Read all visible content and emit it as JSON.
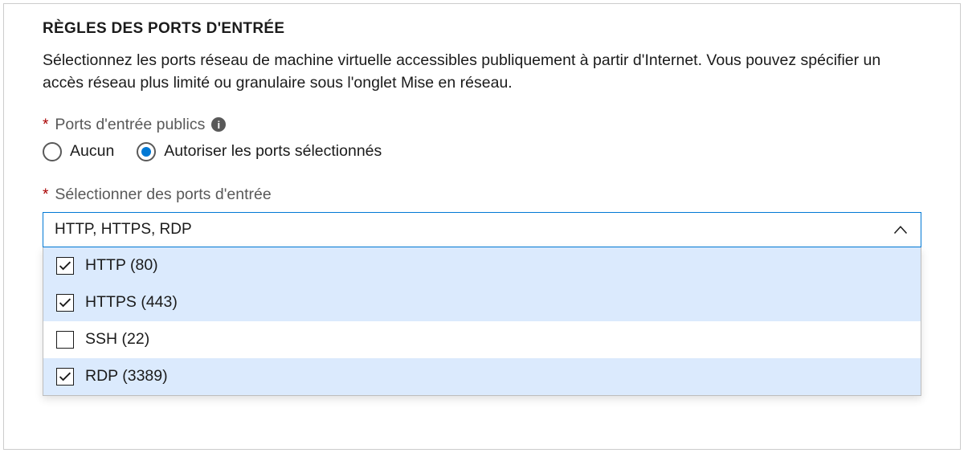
{
  "section": {
    "title": "RÈGLES DES PORTS D'ENTRÉE",
    "description": "Sélectionnez les ports réseau de machine virtuelle accessibles publiquement à partir d'Internet. Vous pouvez spécifier un accès réseau plus limité ou granulaire sous l'onglet Mise en réseau."
  },
  "publicPorts": {
    "label": "Ports d'entrée publics",
    "required": "*",
    "options": {
      "none": "Aucun",
      "allow": "Autoriser les ports sélectionnés"
    },
    "selected": "allow"
  },
  "selectPorts": {
    "label": "Sélectionner des ports d'entrée",
    "required": "*",
    "displayValue": "HTTP, HTTPS, RDP",
    "options": [
      {
        "label": "HTTP (80)",
        "checked": true
      },
      {
        "label": "HTTPS (443)",
        "checked": true
      },
      {
        "label": "SSH (22)",
        "checked": false
      },
      {
        "label": "RDP (3389)",
        "checked": true
      }
    ]
  }
}
